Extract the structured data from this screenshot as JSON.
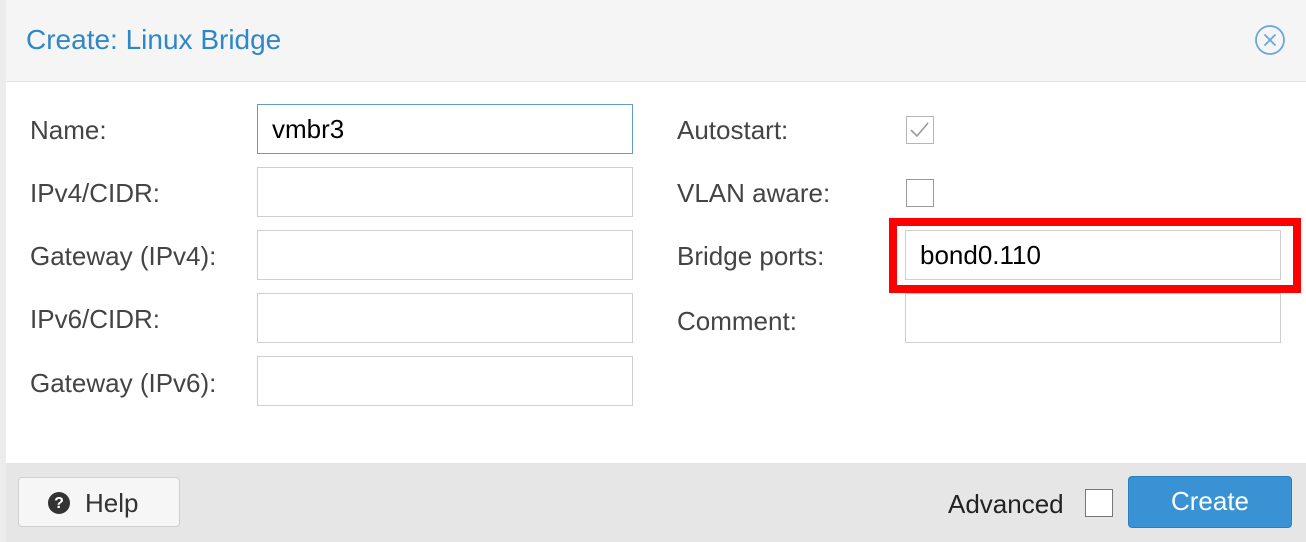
{
  "dialog": {
    "title": "Create: Linux Bridge",
    "close_icon": "close-circle-icon"
  },
  "form": {
    "left": [
      {
        "label": "Name:",
        "value": "vmbr3",
        "placeholder": ""
      },
      {
        "label": "IPv4/CIDR:",
        "value": "",
        "placeholder": ""
      },
      {
        "label": "Gateway (IPv4):",
        "value": "",
        "placeholder": ""
      },
      {
        "label": "IPv6/CIDR:",
        "value": "",
        "placeholder": ""
      },
      {
        "label": "Gateway (IPv6):",
        "value": "",
        "placeholder": ""
      }
    ],
    "right": {
      "autostart": {
        "label": "Autostart:",
        "checked": true
      },
      "vlan_aware": {
        "label": "VLAN aware:",
        "checked": false
      },
      "bridge_ports": {
        "label": "Bridge ports:",
        "value": "bond0.110"
      },
      "comment": {
        "label": "Comment:",
        "value": ""
      }
    }
  },
  "footer": {
    "help_label": "Help",
    "help_icon": "question-circle-icon",
    "advanced_label": "Advanced",
    "advanced_checked": false,
    "create_label": "Create"
  },
  "colors": {
    "title": "#2e87c8",
    "primary_button": "#3892d4",
    "highlight": "#ff0000"
  }
}
